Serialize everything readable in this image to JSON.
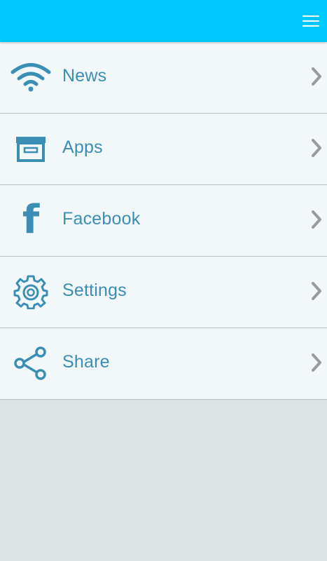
{
  "colors": {
    "topbar": "#00c8ff",
    "accent": "#3b8fb5",
    "row_bg": "#f2f7f9",
    "divider": "#b9bfc2",
    "chevron": "#9a9a9a",
    "page_bg": "#dde3e4"
  },
  "header": {
    "menu_icon": "hamburger-menu-icon"
  },
  "menu": {
    "items": [
      {
        "label": "News",
        "icon": "wifi-icon"
      },
      {
        "label": "Apps",
        "icon": "archive-box-icon"
      },
      {
        "label": "Facebook",
        "icon": "facebook-icon",
        "glyph": "f"
      },
      {
        "label": "Settings",
        "icon": "gear-icon"
      },
      {
        "label": "Share",
        "icon": "share-icon"
      }
    ]
  }
}
